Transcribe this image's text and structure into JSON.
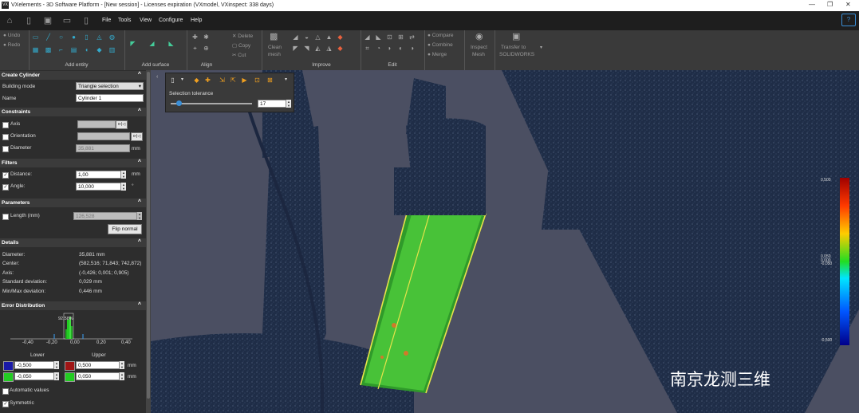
{
  "window": {
    "title": "VXelements - 3D Software Platform - [New session] - Licenses expiration (VXmodel, VXinspect: 338 days)",
    "logo": "VX",
    "controls": [
      "—",
      "❐",
      "✕"
    ]
  },
  "menubar": {
    "items": [
      "File",
      "Tools",
      "View",
      "Configure",
      "Help"
    ]
  },
  "ribbon": {
    "undo": "Undo",
    "redo": "Redo",
    "groups": {
      "add_entity": "Add entity",
      "add_surface": "Add surface",
      "align": "Align",
      "improve": "Improve",
      "edit": "Edit"
    },
    "delete": "Delete",
    "copy": "Copy",
    "cut": "Cut",
    "clean_mesh_1": "Clean",
    "clean_mesh_2": "mesh",
    "compare": "Compare",
    "combine": "Combine",
    "merge": "Merge",
    "inspect_1": "Inspect",
    "inspect_2": "Mesh",
    "transfer_1": "Transfer to",
    "transfer_2": "SOLIDWORKS"
  },
  "panel": {
    "create_cylinder": "Create Cylinder",
    "building_mode_label": "Building mode",
    "building_mode_value": "Triangle selection",
    "name_label": "Name",
    "name_value": "Cylinder 1",
    "constraints": "Constraints",
    "axis": "Axis",
    "orientation": "Orientation",
    "diameter": "Diameter",
    "diameter_value": "35,881",
    "mm": "mm",
    "filters": "Filters",
    "distance": "Distance:",
    "distance_value": "1,00",
    "angle": "Angle:",
    "angle_value": "10,000",
    "deg": "°",
    "parameters": "Parameters",
    "length": "Length (mm)",
    "length_value": "126,528",
    "flip_normal": "Flip normal",
    "details": "Details",
    "details_rows": [
      {
        "k": "Diameter:",
        "v": "35,881 mm"
      },
      {
        "k": "Center:",
        "v": "(582,516; 71,843; 742,872)"
      },
      {
        "k": "Axis:",
        "v": "(-0,426; 0,001; 0,905)"
      },
      {
        "k": "Standard deviation:",
        "v": "0,029 mm"
      },
      {
        "k": "Min/Max deviation:",
        "v": "0,446 mm"
      }
    ],
    "error_distribution": "Error Distribution",
    "hist_peak": "92,58%",
    "hist_ticks": [
      "-0,40",
      "-0,20",
      "0,00",
      "0,20",
      "0,40"
    ],
    "lower": "Lower",
    "upper": "Upper",
    "lower_1": "-0,500",
    "lower_2": "-0,050",
    "upper_1": "0,500",
    "upper_2": "0,050",
    "auto_values": "Automatic values",
    "symmetric": "Symmetric"
  },
  "floating": {
    "selection_tolerance": "Selection tolerance",
    "tolerance_value": "17",
    "tolerance_fraction": 0.1
  },
  "colorbar": {
    "top": "0,500",
    "mid1": "0,050",
    "mid2": "0,000",
    "mid3": "-0,050",
    "bottom": "-0,500"
  },
  "watermark": {
    "text": "南京龙测三维"
  },
  "colors": {
    "accent": "#3a8fd8",
    "green": "#33bb22",
    "model": "#22304a"
  }
}
